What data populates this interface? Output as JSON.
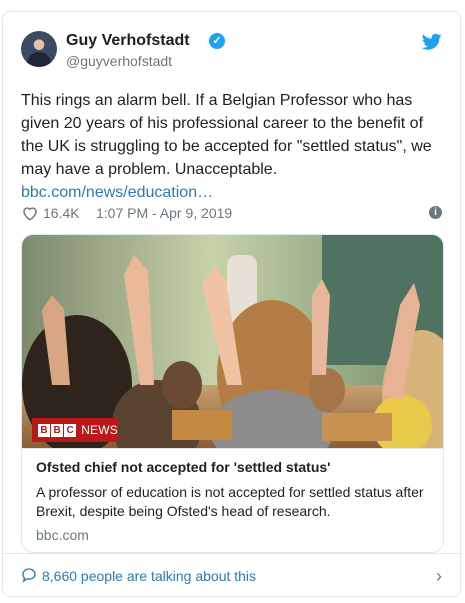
{
  "author": {
    "name": "Guy Verhofstadt",
    "handle": "@guyverhofstadt",
    "verified_icon": "verified-badge-icon"
  },
  "tweet": {
    "text": "This rings an alarm bell. If a Belgian Professor who has given 20 years of his professional career to the benefit of the UK is struggling to be accepted for \"settled status\", we may have a problem. Unacceptable.",
    "link": "bbc.com/news/education…"
  },
  "meta": {
    "likes": "16.4K",
    "time": "1:07 PM - Apr 9, 2019"
  },
  "card": {
    "badge_block_1": "B",
    "badge_block_2": "B",
    "badge_block_3": "C",
    "badge_text": "NEWS",
    "title": "Ofsted chief not accepted for 'settled status'",
    "description": "A professor of education is not accepted for settled status after Brexit, despite being Ofsted's head of research.",
    "domain": "bbc.com"
  },
  "footer": {
    "talking": "8,660 people are talking about this"
  },
  "colors": {
    "link_blue": "#2b7bb9",
    "twitter_blue": "#1da1f2",
    "bbc_red": "#bb1919",
    "muted": "#697882"
  }
}
